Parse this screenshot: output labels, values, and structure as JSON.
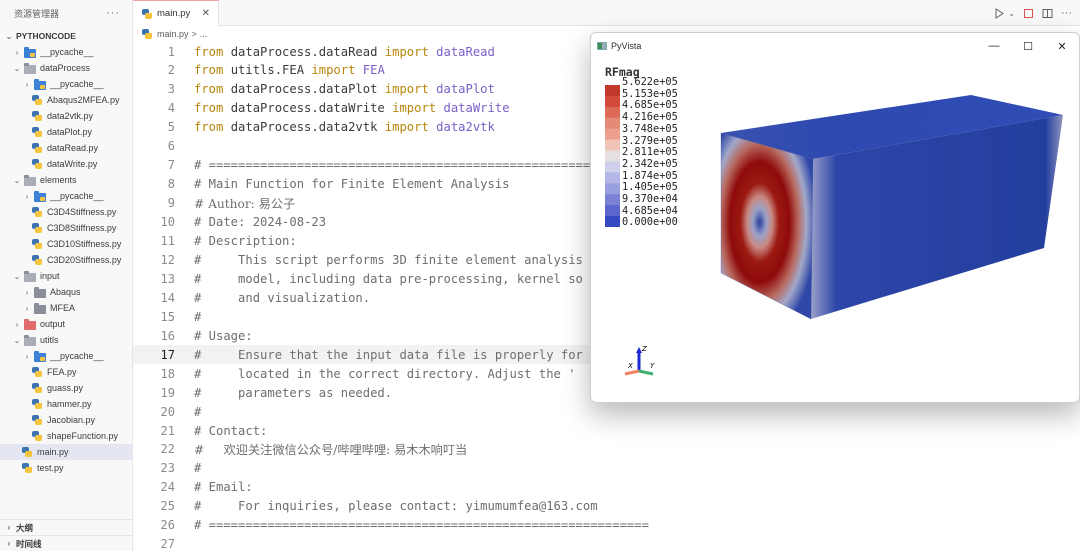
{
  "sidebar": {
    "title": "资源管理器",
    "more_icon": "ellipsis-icon",
    "root": "PYTHONCODE",
    "items": [
      {
        "label": "__pycache__",
        "depth": 0,
        "type": "folder-pycache",
        "state": "collapsed"
      },
      {
        "label": "dataProcess",
        "depth": 0,
        "type": "folder",
        "state": "expanded"
      },
      {
        "label": "__pycache__",
        "depth": 1,
        "type": "folder-pycache",
        "state": "collapsed"
      },
      {
        "label": "Abaqus2MFEA.py",
        "depth": 1,
        "type": "py"
      },
      {
        "label": "data2vtk.py",
        "depth": 1,
        "type": "py"
      },
      {
        "label": "dataPlot.py",
        "depth": 1,
        "type": "py"
      },
      {
        "label": "dataRead.py",
        "depth": 1,
        "type": "py"
      },
      {
        "label": "dataWrite.py",
        "depth": 1,
        "type": "py"
      },
      {
        "label": "elements",
        "depth": 0,
        "type": "folder",
        "state": "expanded"
      },
      {
        "label": "__pycache__",
        "depth": 1,
        "type": "folder-pycache",
        "state": "collapsed"
      },
      {
        "label": "C3D4Stiffness.py",
        "depth": 1,
        "type": "py"
      },
      {
        "label": "C3D8Stiffness.py",
        "depth": 1,
        "type": "py"
      },
      {
        "label": "C3D10Stiffness.py",
        "depth": 1,
        "type": "py"
      },
      {
        "label": "C3D20Stiffness.py",
        "depth": 1,
        "type": "py"
      },
      {
        "label": "input",
        "depth": 0,
        "type": "folder",
        "state": "expanded"
      },
      {
        "label": "Abaqus",
        "depth": 1,
        "type": "folder-closed",
        "state": "collapsed"
      },
      {
        "label": "MFEA",
        "depth": 1,
        "type": "folder-closed",
        "state": "collapsed"
      },
      {
        "label": "output",
        "depth": 0,
        "type": "folder-output",
        "state": "collapsed"
      },
      {
        "label": "utitls",
        "depth": 0,
        "type": "folder",
        "state": "expanded"
      },
      {
        "label": "__pycache__",
        "depth": 1,
        "type": "folder-pycache",
        "state": "collapsed"
      },
      {
        "label": "FEA.py",
        "depth": 1,
        "type": "py"
      },
      {
        "label": "guass.py",
        "depth": 1,
        "type": "py"
      },
      {
        "label": "hammer.py",
        "depth": 1,
        "type": "py"
      },
      {
        "label": "Jacobian.py",
        "depth": 1,
        "type": "py"
      },
      {
        "label": "shapeFunction.py",
        "depth": 1,
        "type": "py"
      },
      {
        "label": "main.py",
        "depth": 0,
        "type": "py",
        "selected": true
      },
      {
        "label": "test.py",
        "depth": 0,
        "type": "py"
      }
    ],
    "bottom": [
      {
        "label": "大纲"
      },
      {
        "label": "时间线"
      }
    ]
  },
  "tabs": [
    {
      "label": "main.py",
      "active": true,
      "close_icon": "close-icon"
    }
  ],
  "breadcrumb": {
    "file": "main.py",
    "separator": ">",
    "rest": "..."
  },
  "editor_actions": [
    "run-icon",
    "run-dropdown-icon",
    "stop-icon",
    "split-editor-icon",
    "more-actions-icon"
  ],
  "code": {
    "current_line": 17,
    "lines": [
      {
        "n": "1",
        "tokens": [
          [
            "kw",
            "from "
          ],
          [
            "mod",
            "dataProcess.dataRead "
          ],
          [
            "kw",
            "import "
          ],
          [
            "cls",
            "dataRead"
          ]
        ]
      },
      {
        "n": "2",
        "tokens": [
          [
            "kw",
            "from "
          ],
          [
            "mod",
            "utitls.FEA "
          ],
          [
            "kw",
            "import "
          ],
          [
            "cls",
            "FEA"
          ]
        ]
      },
      {
        "n": "3",
        "tokens": [
          [
            "kw",
            "from "
          ],
          [
            "mod",
            "dataProcess.dataPlot "
          ],
          [
            "kw",
            "import "
          ],
          [
            "cls",
            "dataPlot"
          ]
        ]
      },
      {
        "n": "4",
        "tokens": [
          [
            "kw",
            "from "
          ],
          [
            "mod",
            "dataProcess.dataWrite "
          ],
          [
            "kw",
            "import "
          ],
          [
            "cls",
            "dataWrite"
          ]
        ]
      },
      {
        "n": "5",
        "tokens": [
          [
            "kw",
            "from "
          ],
          [
            "mod",
            "dataProcess.data2vtk "
          ],
          [
            "kw",
            "import "
          ],
          [
            "cls",
            "data2vtk"
          ]
        ]
      },
      {
        "n": "6",
        "tokens": []
      },
      {
        "n": "7",
        "tokens": [
          [
            "cm",
            "# ============================================================"
          ]
        ]
      },
      {
        "n": "8",
        "tokens": [
          [
            "cm",
            "# Main Function for Finite Element Analysis"
          ]
        ]
      },
      {
        "n": "9",
        "tokens": [
          [
            "cm",
            "# Author: 易公子"
          ]
        ]
      },
      {
        "n": "10",
        "tokens": [
          [
            "cm",
            "# Date: 2024-08-23"
          ]
        ]
      },
      {
        "n": "11",
        "tokens": [
          [
            "cm",
            "# Description:"
          ]
        ]
      },
      {
        "n": "12",
        "tokens": [
          [
            "cm",
            "#     This script performs 3D finite element analysis"
          ]
        ]
      },
      {
        "n": "13",
        "tokens": [
          [
            "cm",
            "#     model, including data pre-processing, kernel so"
          ]
        ]
      },
      {
        "n": "14",
        "tokens": [
          [
            "cm",
            "#     and visualization."
          ]
        ]
      },
      {
        "n": "15",
        "tokens": [
          [
            "cm",
            "#"
          ]
        ]
      },
      {
        "n": "16",
        "tokens": [
          [
            "cm",
            "# Usage:"
          ]
        ]
      },
      {
        "n": "17",
        "tokens": [
          [
            "cm",
            "#     Ensure that the input data file is properly for"
          ]
        ]
      },
      {
        "n": "18",
        "tokens": [
          [
            "cm",
            "#     located in the correct directory. Adjust the '"
          ]
        ]
      },
      {
        "n": "19",
        "tokens": [
          [
            "cm",
            "#     parameters as needed."
          ]
        ]
      },
      {
        "n": "20",
        "tokens": [
          [
            "cm",
            "#"
          ]
        ]
      },
      {
        "n": "21",
        "tokens": [
          [
            "cm",
            "# Contact:"
          ]
        ]
      },
      {
        "n": "22",
        "tokens": [
          [
            "cm",
            "#     欢迎关注微信公众号/哔哩哔哩: 易木木响叮当"
          ]
        ]
      },
      {
        "n": "23",
        "tokens": [
          [
            "cm",
            "#"
          ]
        ]
      },
      {
        "n": "24",
        "tokens": [
          [
            "cm",
            "# Email:"
          ]
        ]
      },
      {
        "n": "25",
        "tokens": [
          [
            "cm",
            "#     For inquiries, please contact: yimumumfea@163.com"
          ]
        ]
      },
      {
        "n": "26",
        "tokens": [
          [
            "cm",
            "# ============================================================"
          ]
        ]
      },
      {
        "n": "27",
        "tokens": []
      }
    ]
  },
  "pyvista": {
    "title": "PyVista",
    "window_buttons": {
      "minimize": "—",
      "maximize": "☐",
      "close": "✕"
    },
    "scalar_bar": {
      "title": "RFmag",
      "labels": [
        "5.622e+05",
        "5.153e+05",
        "4.685e+05",
        "4.216e+05",
        "3.748e+05",
        "3.279e+05",
        "2.811e+05",
        "2.342e+05",
        "1.874e+05",
        "1.405e+05",
        "9.370e+04",
        "4.685e+04",
        "0.000e+00"
      ],
      "colors": [
        "#c0392b",
        "#d14a3a",
        "#dc6a57",
        "#e58a77",
        "#ec9f8e",
        "#f0c4b6",
        "#e6e1e0",
        "#d0d0ec",
        "#b3b6e6",
        "#9a9fe0",
        "#7b82d6",
        "#5b66cc",
        "#3348c2"
      ]
    },
    "axes": {
      "x": "X",
      "y": "Y",
      "z": "Z",
      "x_color": "#f08060",
      "y_color": "#40b070",
      "z_color": "#1a28d6"
    },
    "mesh_colors": {
      "base": "#233f9e",
      "hot": "#8f0a0a"
    }
  }
}
